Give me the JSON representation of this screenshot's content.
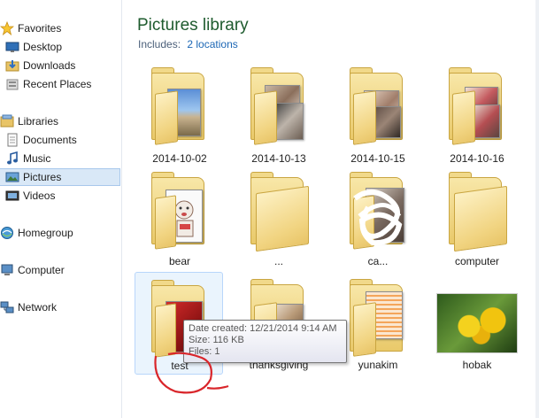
{
  "nav": {
    "favorites": "Favorites",
    "desktop": "Desktop",
    "downloads": "Downloads",
    "recent_places": "Recent Places",
    "libraries": "Libraries",
    "documents": "Documents",
    "music": "Music",
    "pictures": "Pictures",
    "videos": "Videos",
    "homegroup": "Homegroup",
    "computer": "Computer",
    "network": "Network"
  },
  "library": {
    "title": "Pictures library",
    "includes_label": "Includes:",
    "locations_link": "2 locations"
  },
  "items": [
    {
      "name": "2014-10-02"
    },
    {
      "name": "2014-10-13"
    },
    {
      "name": "2014-10-15"
    },
    {
      "name": "2014-10-16"
    },
    {
      "name": "bear"
    },
    {
      "name": "..."
    },
    {
      "name": "ca..."
    },
    {
      "name": "computer"
    },
    {
      "name": "test"
    },
    {
      "name": "thanksgiving"
    },
    {
      "name": "yunakim"
    },
    {
      "name": "hobak"
    }
  ],
  "tooltip": {
    "date_created": "Date created: 12/21/2014 9:14 AM",
    "size": "Size: 116 KB",
    "files": "Files: 1"
  },
  "colors": {
    "title": "#1e5b2e",
    "link": "#1c67b5",
    "selection": "#d9e8f7",
    "annotation": "#d9262b"
  },
  "icons": [
    "star-icon",
    "desktop-icon",
    "downloads-icon",
    "recent-places-icon",
    "libraries-icon",
    "documents-icon",
    "music-icon",
    "pictures-icon",
    "videos-icon",
    "homegroup-icon",
    "computer-icon",
    "network-icon",
    "folder-icon"
  ]
}
